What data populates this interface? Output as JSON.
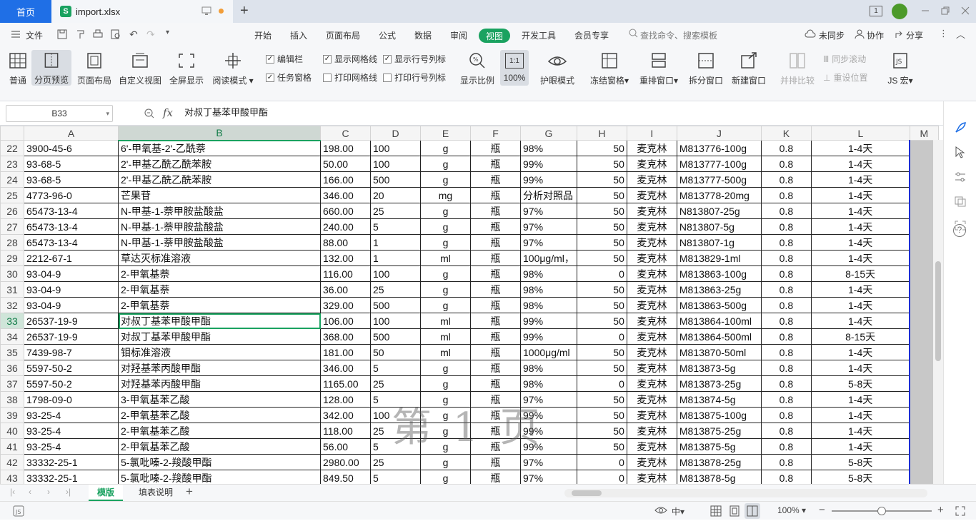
{
  "tabbar": {
    "home_label": "首页",
    "file_name": "import.xlsx",
    "file_icon_letter": "S",
    "new_tab_symbol": "+",
    "page_count_badge": "1"
  },
  "menubar": {
    "file_label": "文件",
    "tabs": [
      "开始",
      "插入",
      "页面布局",
      "公式",
      "数据",
      "审阅",
      "视图",
      "开发工具",
      "会员专享"
    ],
    "search_label": "查找命令、搜索模板",
    "unsync_label": "未同步",
    "collab_label": "协作",
    "share_label": "分享"
  },
  "ribbon": {
    "buttons": [
      "普通",
      "分页预览",
      "页面布局",
      "自定义视图",
      "全屏显示",
      "阅读模式"
    ],
    "checkboxes": [
      {
        "label": "编辑栏",
        "checked": true
      },
      {
        "label": "显示网格线",
        "checked": true
      },
      {
        "label": "显示行号列标",
        "checked": true
      },
      {
        "label": "任务窗格",
        "checked": true
      },
      {
        "label": "打印网格线",
        "checked": false
      },
      {
        "label": "打印行号列标",
        "checked": false
      }
    ],
    "zoom_label": "显示比例",
    "zoom_100_icon": "1:1",
    "zoom_100_label": "100%",
    "eye_label": "护眼模式",
    "freeze_label": "冻结窗格",
    "rearrange_label": "重排窗口",
    "split_label": "拆分窗口",
    "new_window_label": "新建窗口",
    "side_by_side_label": "并排比较",
    "sync_scroll_label": "同步滚动",
    "reset_pos_label": "重设位置",
    "js_macro_label": "JS 宏"
  },
  "formula_bar": {
    "name_box": "B33",
    "fx_label": "fx",
    "content": "对叔丁基苯甲酸甲酯"
  },
  "sheet": {
    "columns": [
      "A",
      "B",
      "C",
      "D",
      "E",
      "F",
      "G",
      "H",
      "I",
      "J",
      "K",
      "L",
      "M"
    ],
    "selected_cell": "B33",
    "watermark": "第 1 页",
    "rows": [
      {
        "n": "22",
        "cells": [
          "3900-45-6",
          "6'-甲氧基-2'-乙酰萘",
          "198.00",
          "100",
          "g",
          "瓶",
          "98%",
          "50",
          "麦克林",
          "M813776-100g",
          "0.8",
          "1-4天"
        ]
      },
      {
        "n": "23",
        "cells": [
          "93-68-5",
          "2'-甲基乙酰乙酰苯胺",
          "50.00",
          "100",
          "g",
          "瓶",
          "99%",
          "50",
          "麦克林",
          "M813777-100g",
          "0.8",
          "1-4天"
        ]
      },
      {
        "n": "24",
        "cells": [
          "93-68-5",
          "2'-甲基乙酰乙酰苯胺",
          "166.00",
          "500",
          "g",
          "瓶",
          "99%",
          "50",
          "麦克林",
          "M813777-500g",
          "0.8",
          "1-4天"
        ]
      },
      {
        "n": "25",
        "cells": [
          "4773-96-0",
          "芒果苷",
          "346.00",
          "20",
          "mg",
          "瓶",
          "分析对照品",
          "50",
          "麦克林",
          "M813778-20mg",
          "0.8",
          "1-4天"
        ]
      },
      {
        "n": "26",
        "cells": [
          "65473-13-4",
          "N-甲基-1-萘甲胺盐酸盐",
          "660.00",
          "25",
          "g",
          "瓶",
          "97%",
          "50",
          "麦克林",
          "N813807-25g",
          "0.8",
          "1-4天"
        ]
      },
      {
        "n": "27",
        "cells": [
          "65473-13-4",
          "N-甲基-1-萘甲胺盐酸盐",
          "240.00",
          "5",
          "g",
          "瓶",
          "97%",
          "50",
          "麦克林",
          "N813807-5g",
          "0.8",
          "1-4天"
        ]
      },
      {
        "n": "28",
        "cells": [
          "65473-13-4",
          "N-甲基-1-萘甲胺盐酸盐",
          "88.00",
          "1",
          "g",
          "瓶",
          "97%",
          "50",
          "麦克林",
          "N813807-1g",
          "0.8",
          "1-4天"
        ]
      },
      {
        "n": "29",
        "cells": [
          "2212-67-1",
          "草达灭标准溶液",
          "132.00",
          "1",
          "ml",
          "瓶",
          "100μg/ml，",
          "50",
          "麦克林",
          "M813829-1ml",
          "0.8",
          "1-4天"
        ]
      },
      {
        "n": "30",
        "cells": [
          "93-04-9",
          "2-甲氧基萘",
          "116.00",
          "100",
          "g",
          "瓶",
          "98%",
          "0",
          "麦克林",
          "M813863-100g",
          "0.8",
          "8-15天"
        ]
      },
      {
        "n": "31",
        "cells": [
          "93-04-9",
          "2-甲氧基萘",
          "36.00",
          "25",
          "g",
          "瓶",
          "98%",
          "50",
          "麦克林",
          "M813863-25g",
          "0.8",
          "1-4天"
        ]
      },
      {
        "n": "32",
        "cells": [
          "93-04-9",
          "2-甲氧基萘",
          "329.00",
          "500",
          "g",
          "瓶",
          "98%",
          "50",
          "麦克林",
          "M813863-500g",
          "0.8",
          "1-4天"
        ]
      },
      {
        "n": "33",
        "cells": [
          "26537-19-9",
          "对叔丁基苯甲酸甲酯",
          "106.00",
          "100",
          "ml",
          "瓶",
          "99%",
          "50",
          "麦克林",
          "M813864-100ml",
          "0.8",
          "1-4天"
        ]
      },
      {
        "n": "34",
        "cells": [
          "26537-19-9",
          "对叔丁基苯甲酸甲酯",
          "368.00",
          "500",
          "ml",
          "瓶",
          "99%",
          "0",
          "麦克林",
          "M813864-500ml",
          "0.8",
          "8-15天"
        ]
      },
      {
        "n": "35",
        "cells": [
          "7439-98-7",
          "钼标准溶液",
          "181.00",
          "50",
          "ml",
          "瓶",
          "1000μg/ml",
          "50",
          "麦克林",
          "M813870-50ml",
          "0.8",
          "1-4天"
        ]
      },
      {
        "n": "36",
        "cells": [
          "5597-50-2",
          "对羟基苯丙酸甲酯",
          "346.00",
          "5",
          "g",
          "瓶",
          "98%",
          "50",
          "麦克林",
          "M813873-5g",
          "0.8",
          "1-4天"
        ]
      },
      {
        "n": "37",
        "cells": [
          "5597-50-2",
          "对羟基苯丙酸甲酯",
          "1165.00",
          "25",
          "g",
          "瓶",
          "98%",
          "0",
          "麦克林",
          "M813873-25g",
          "0.8",
          "5-8天"
        ]
      },
      {
        "n": "38",
        "cells": [
          "1798-09-0",
          "3-甲氧基苯乙酸",
          "128.00",
          "5",
          "g",
          "瓶",
          "97%",
          "50",
          "麦克林",
          "M813874-5g",
          "0.8",
          "1-4天"
        ]
      },
      {
        "n": "39",
        "cells": [
          "93-25-4",
          "2-甲氧基苯乙酸",
          "342.00",
          "100",
          "g",
          "瓶",
          "99%",
          "50",
          "麦克林",
          "M813875-100g",
          "0.8",
          "1-4天"
        ]
      },
      {
        "n": "40",
        "cells": [
          "93-25-4",
          "2-甲氧基苯乙酸",
          "118.00",
          "25",
          "g",
          "瓶",
          "99%",
          "50",
          "麦克林",
          "M813875-25g",
          "0.8",
          "1-4天"
        ]
      },
      {
        "n": "41",
        "cells": [
          "93-25-4",
          "2-甲氧基苯乙酸",
          "56.00",
          "5",
          "g",
          "瓶",
          "99%",
          "50",
          "麦克林",
          "M813875-5g",
          "0.8",
          "1-4天"
        ]
      },
      {
        "n": "42",
        "cells": [
          "33332-25-1",
          "5-氯吡嗪-2-羧酸甲酯",
          "2980.00",
          "25",
          "g",
          "瓶",
          "97%",
          "0",
          "麦克林",
          "M813878-25g",
          "0.8",
          "5-8天"
        ]
      },
      {
        "n": "43",
        "cells": [
          "33332-25-1",
          "5-氯吡嗪-2-羧酸甲酯",
          "849.50",
          "5",
          "g",
          "瓶",
          "97%",
          "0",
          "麦克林",
          "M813878-5g",
          "0.8",
          "5-8天"
        ]
      }
    ]
  },
  "sheet_tabs": {
    "tabs": [
      "模版",
      "填表说明"
    ],
    "active": "模版",
    "add_symbol": "+"
  },
  "status_bar": {
    "zoom": "100%",
    "input_mode": "中"
  },
  "colors": {
    "accent_green": "#1aa260",
    "home_blue": "#1f6fe6",
    "page_border_blue": "#1d2fd4"
  }
}
